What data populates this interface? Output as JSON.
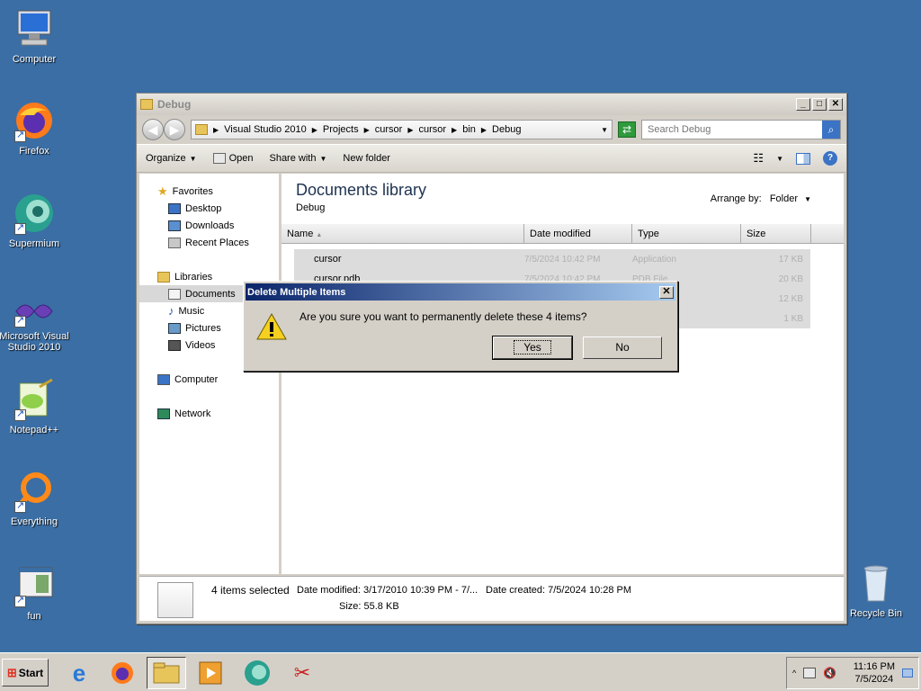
{
  "desktop": {
    "icons": [
      {
        "label": "Computer"
      },
      {
        "label": "Firefox"
      },
      {
        "label": "Supermium"
      },
      {
        "label": "Microsoft Visual Studio 2010"
      },
      {
        "label": "Notepad++"
      },
      {
        "label": "Everything"
      },
      {
        "label": "fun"
      },
      {
        "label": "Recycle Bin"
      }
    ]
  },
  "window": {
    "title": "Debug",
    "breadcrumb": [
      "Visual Studio 2010",
      "Projects",
      "cursor",
      "cursor",
      "bin",
      "Debug"
    ],
    "search_placeholder": "Search Debug",
    "toolbar": {
      "organize": "Organize",
      "open": "Open",
      "share": "Share with",
      "new_folder": "New folder"
    },
    "nav": {
      "favorites": "Favorites",
      "desktop": "Desktop",
      "downloads": "Downloads",
      "recent": "Recent Places",
      "libraries": "Libraries",
      "documents": "Documents",
      "music": "Music",
      "pictures": "Pictures",
      "videos": "Videos",
      "computer": "Computer",
      "network": "Network"
    },
    "library_title": "Documents library",
    "library_sub": "Debug",
    "arrange_label": "Arrange by:",
    "arrange_value": "Folder",
    "columns": {
      "name": "Name",
      "date": "Date modified",
      "type": "Type",
      "size": "Size"
    },
    "files": [
      {
        "name": "cursor",
        "date": "7/5/2024 10:42 PM",
        "type": "Application",
        "size": "17 KB"
      },
      {
        "name": "cursor.pdb",
        "date": "7/5/2024 10:42 PM",
        "type": "PDB File",
        "size": "20 KB"
      },
      {
        "name": "",
        "date": "",
        "type": "n",
        "size": "12 KB"
      },
      {
        "name": "",
        "date": "",
        "type": "T File",
        "size": "1 KB"
      }
    ],
    "details": {
      "selected": "4 items selected",
      "date_modified": "Date modified: 3/17/2010 10:39 PM - 7/...",
      "date_created": "Date created: 7/5/2024 10:28 PM",
      "size": "Size: 55.8 KB"
    }
  },
  "dialog": {
    "title": "Delete Multiple Items",
    "message": "Are you sure you want to permanently delete these 4 items?",
    "yes": "Yes",
    "no": "No"
  },
  "taskbar": {
    "start": "Start",
    "time": "11:16 PM",
    "date": "7/5/2024"
  }
}
